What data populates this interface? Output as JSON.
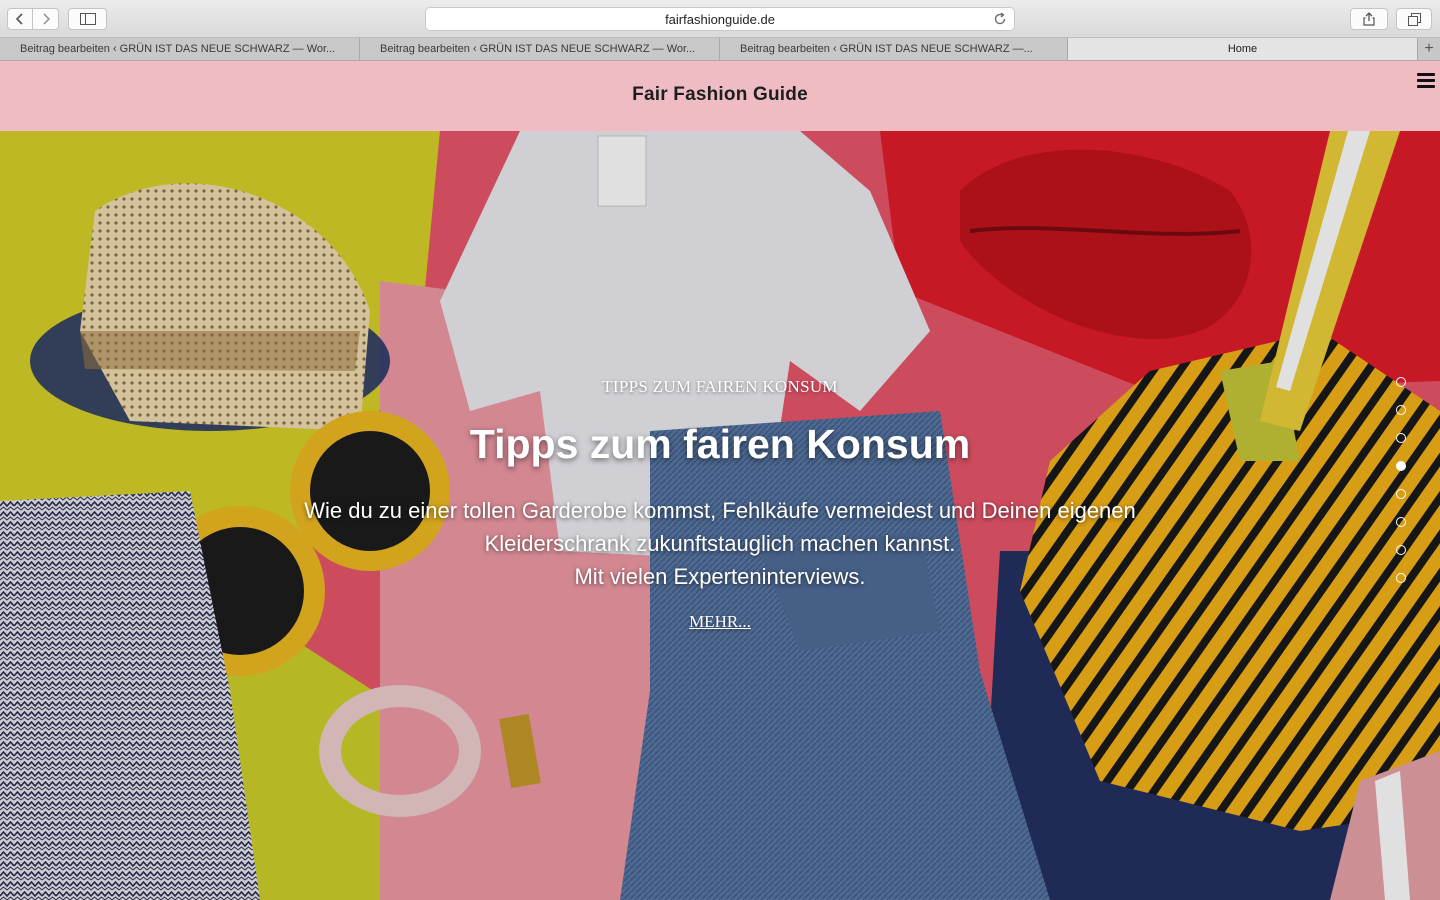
{
  "browser": {
    "url": "fairfashionguide.de",
    "tabs": [
      {
        "label": "Beitrag bearbeiten ‹ GRÜN IST DAS NEUE SCHWARZ — Wor..."
      },
      {
        "label": "Beitrag bearbeiten ‹ GRÜN IST DAS NEUE SCHWARZ — Wor..."
      },
      {
        "label": "Beitrag bearbeiten ‹ GRÜN IST DAS NEUE SCHWARZ —..."
      },
      {
        "label": "Home"
      }
    ],
    "new_tab_label": "+"
  },
  "site": {
    "title": "Fair Fashion Guide",
    "header_color": "#efbcc4"
  },
  "hero": {
    "kicker": "TIPPS ZUM FAIREN KONSUM",
    "title": "Tipps zum fairen Konsum",
    "text_lines": [
      "Wie du zu einer tollen Garderobe kommst, Fehlkäufe vermeidest und Deinen eigenen",
      "Kleiderschrank zukunftstauglich machen kannst.",
      "Mit vielen Experteninterviews."
    ],
    "more_label": "MEHR...",
    "slider": {
      "slides": 8,
      "active_index": 3
    }
  }
}
